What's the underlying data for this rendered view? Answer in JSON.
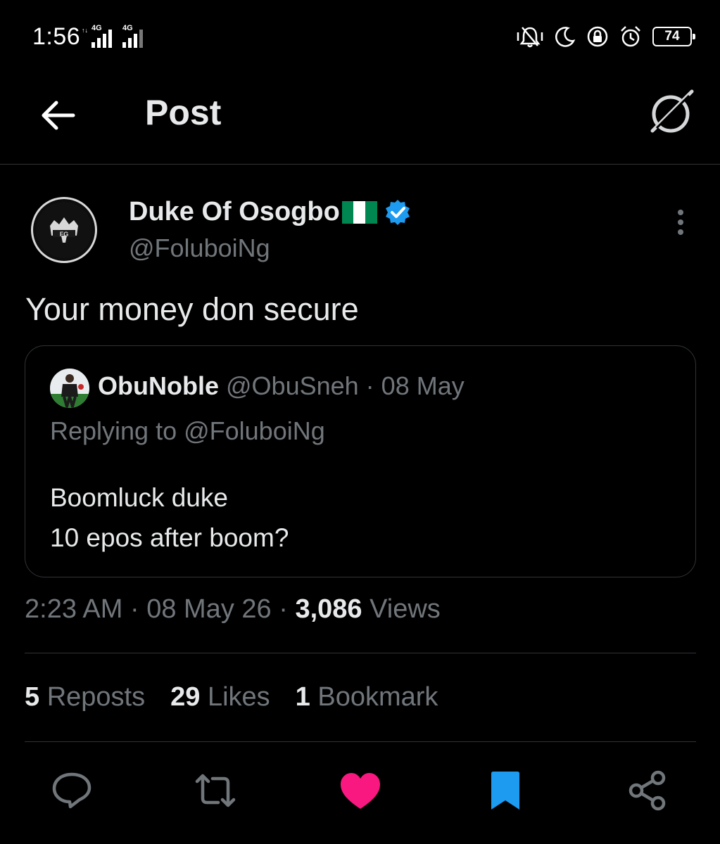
{
  "status_bar": {
    "time": "1:56",
    "signal_1": "4G",
    "signal_2": "4G",
    "battery": "74",
    "icons": [
      "vibrate-icon",
      "do-not-disturb-moon-icon",
      "lock-icon",
      "alarm-icon",
      "battery-icon"
    ]
  },
  "nav": {
    "title": "Post"
  },
  "post": {
    "author_name": "Duke Of Osogbo",
    "author_handle": "@FoluboiNg",
    "text": "Your money don secure",
    "quote": {
      "name": "ObuNoble",
      "handle": "@ObuSneh",
      "separator": " · ",
      "date": "08 May",
      "replying": "Replying to @FoluboiNg",
      "body_line1": "Boomluck duke",
      "body_line2": "10 epos after boom?"
    },
    "time": "2:23 AM",
    "date": "08 May 26",
    "views_count": "3,086",
    "views_label": "Views",
    "dot": " · "
  },
  "stats": {
    "reposts_count": "5",
    "reposts_label": "Reposts",
    "likes_count": "29",
    "likes_label": "Likes",
    "bookmarks_count": "1",
    "bookmarks_label": "Bookmark"
  },
  "colors": {
    "background": "#000000",
    "text": "#e7e9ea",
    "muted": "#71767b",
    "border": "#2f3336",
    "verified": "#1d9bf0",
    "like": "#f91880",
    "bookmark": "#1d9bf0",
    "flag_green": "#008751"
  }
}
